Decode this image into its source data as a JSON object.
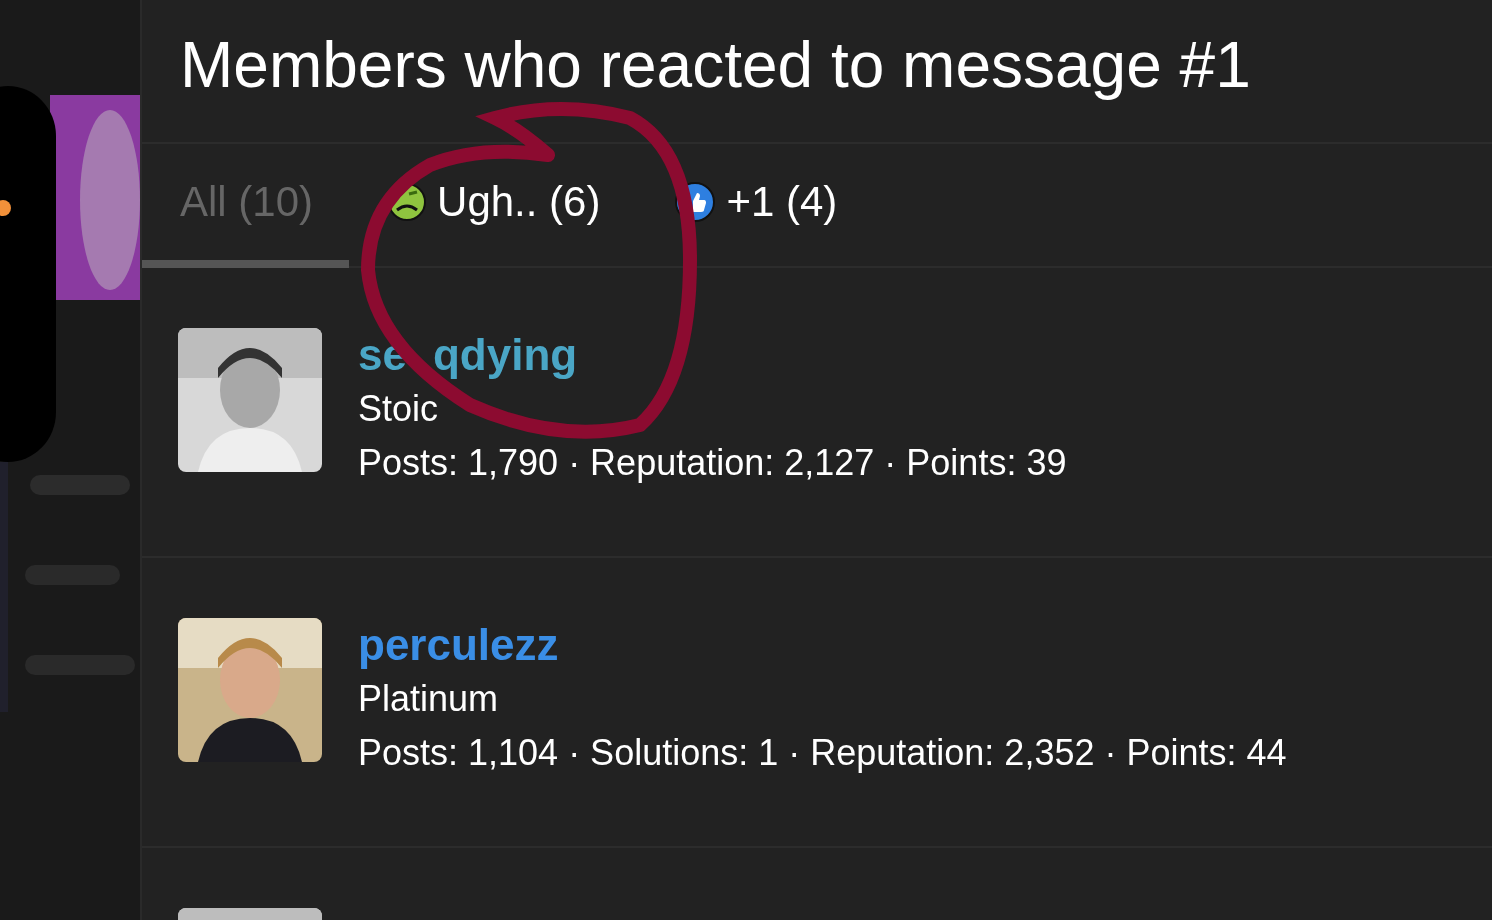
{
  "title": "Members who reacted to message #1",
  "tabs": [
    {
      "label": "All (10)",
      "kind": "all",
      "selected": true
    },
    {
      "label": "Ugh.. (6)",
      "kind": "ugh",
      "selected": false
    },
    {
      "label": "+1 (4)",
      "kind": "like",
      "selected": false
    }
  ],
  "members": [
    {
      "name_parts": [
        "se",
        "qdying"
      ],
      "color": "#4aa6c6",
      "title": "Stoic",
      "stats": "Posts: 1,790 · Reputation: 2,127 · Points: 39",
      "avatar": {
        "kind": "picture"
      }
    },
    {
      "name_parts": [
        "perculezz"
      ],
      "color": "#3a8ee6",
      "title": "Platinum",
      "stats": "Posts: 1,104 · Solutions: 1 · Reputation: 2,352 · Points: 44",
      "avatar": {
        "kind": "picture"
      }
    },
    {
      "avatar": {
        "kind": "picture"
      }
    }
  ]
}
